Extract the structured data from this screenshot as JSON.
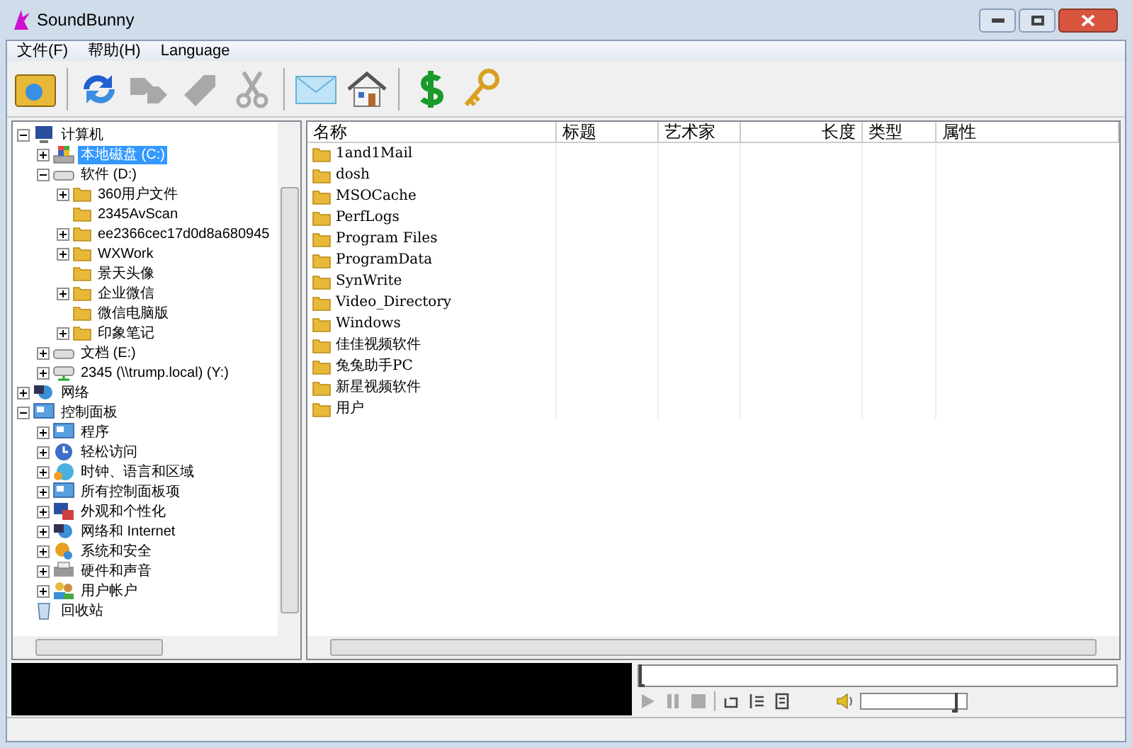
{
  "window": {
    "title": "SoundBunny"
  },
  "menu": [
    {
      "label": "文件(F)"
    },
    {
      "label": "帮助(H)"
    },
    {
      "label": "Language"
    }
  ],
  "toolbar": [
    {
      "kind": "open",
      "disabled": false
    },
    {
      "kind": "separator"
    },
    {
      "kind": "refresh",
      "disabled": false
    },
    {
      "kind": "tags",
      "disabled": true
    },
    {
      "kind": "tag",
      "disabled": true
    },
    {
      "kind": "cut",
      "disabled": true
    },
    {
      "kind": "separator"
    },
    {
      "kind": "mail",
      "disabled": false
    },
    {
      "kind": "home",
      "disabled": false
    },
    {
      "kind": "separator"
    },
    {
      "kind": "dollar",
      "disabled": false
    },
    {
      "kind": "key",
      "disabled": false
    }
  ],
  "tree": [
    {
      "label": "计算机",
      "kind": "computer",
      "expandable": true,
      "expanded": true,
      "selected": false,
      "children": [
        {
          "label": "本地磁盘 (C:)",
          "kind": "drive",
          "expandable": true,
          "expanded": false,
          "selected": true
        },
        {
          "label": "软件 (D:)",
          "kind": "disk",
          "expandable": true,
          "expanded": true,
          "selected": false,
          "children": [
            {
              "label": "360用户文件",
              "kind": "folder",
              "expandable": true,
              "expanded": false,
              "selected": false
            },
            {
              "label": "2345AvScan",
              "kind": "folder",
              "expandable": false,
              "selected": false
            },
            {
              "label": "ee2366cec17d0d8a680945",
              "kind": "folder",
              "expandable": true,
              "expanded": false,
              "selected": false
            },
            {
              "label": "WXWork",
              "kind": "folder",
              "expandable": true,
              "expanded": false,
              "selected": false
            },
            {
              "label": "景天头像",
              "kind": "folder",
              "expandable": false,
              "selected": false
            },
            {
              "label": "企业微信",
              "kind": "folder",
              "expandable": true,
              "expanded": false,
              "selected": false
            },
            {
              "label": "微信电脑版",
              "kind": "folder",
              "expandable": false,
              "selected": false
            },
            {
              "label": "印象笔记",
              "kind": "folder",
              "expandable": true,
              "expanded": false,
              "selected": false
            }
          ]
        },
        {
          "label": "文档 (E:)",
          "kind": "disk",
          "expandable": true,
          "expanded": false,
          "selected": false
        },
        {
          "label": "2345 (\\\\trump.local) (Y:)",
          "kind": "netdrive",
          "expandable": true,
          "expanded": false,
          "selected": false
        }
      ]
    },
    {
      "label": "网络",
      "kind": "network",
      "expandable": true,
      "expanded": false,
      "selected": false
    },
    {
      "label": "控制面板",
      "kind": "panel",
      "expandable": true,
      "expanded": true,
      "selected": false,
      "children": [
        {
          "label": "程序",
          "kind": "panel",
          "expandable": true,
          "expanded": false,
          "selected": false
        },
        {
          "label": "轻松访问",
          "kind": "clock",
          "expandable": true,
          "expanded": false,
          "selected": false
        },
        {
          "label": "时钟、语言和区域",
          "kind": "globe",
          "expandable": true,
          "expanded": false,
          "selected": false
        },
        {
          "label": "所有控制面板项",
          "kind": "panel",
          "expandable": true,
          "expanded": false,
          "selected": false
        },
        {
          "label": "外观和个性化",
          "kind": "display",
          "expandable": true,
          "expanded": false,
          "selected": false
        },
        {
          "label": "网络和 Internet",
          "kind": "network",
          "expandable": true,
          "expanded": false,
          "selected": false
        },
        {
          "label": "系统和安全",
          "kind": "shield",
          "expandable": true,
          "expanded": false,
          "selected": false
        },
        {
          "label": "硬件和声音",
          "kind": "printer",
          "expandable": true,
          "expanded": false,
          "selected": false
        },
        {
          "label": "用户帐户",
          "kind": "users",
          "expandable": true,
          "expanded": false,
          "selected": false
        }
      ]
    },
    {
      "label": "回收站",
      "kind": "recycle",
      "expandable": false,
      "selected": false
    }
  ],
  "table": {
    "columns": [
      "名称",
      "标题",
      "艺术家",
      "长度",
      "类型",
      "属性"
    ],
    "rows": [
      {
        "name": "1and1Mail"
      },
      {
        "name": "dosh"
      },
      {
        "name": "MSOCache"
      },
      {
        "name": "PerfLogs"
      },
      {
        "name": "Program Files"
      },
      {
        "name": "ProgramData"
      },
      {
        "name": "SynWrite"
      },
      {
        "name": "Video_Directory"
      },
      {
        "name": "Windows"
      },
      {
        "name": "佳佳视频软件"
      },
      {
        "name": "兔兔助手PC"
      },
      {
        "name": "新星视频软件"
      },
      {
        "name": "用户"
      }
    ]
  },
  "player": {
    "seek": {
      "level": 0
    },
    "volume": {
      "level": 0.92
    }
  }
}
